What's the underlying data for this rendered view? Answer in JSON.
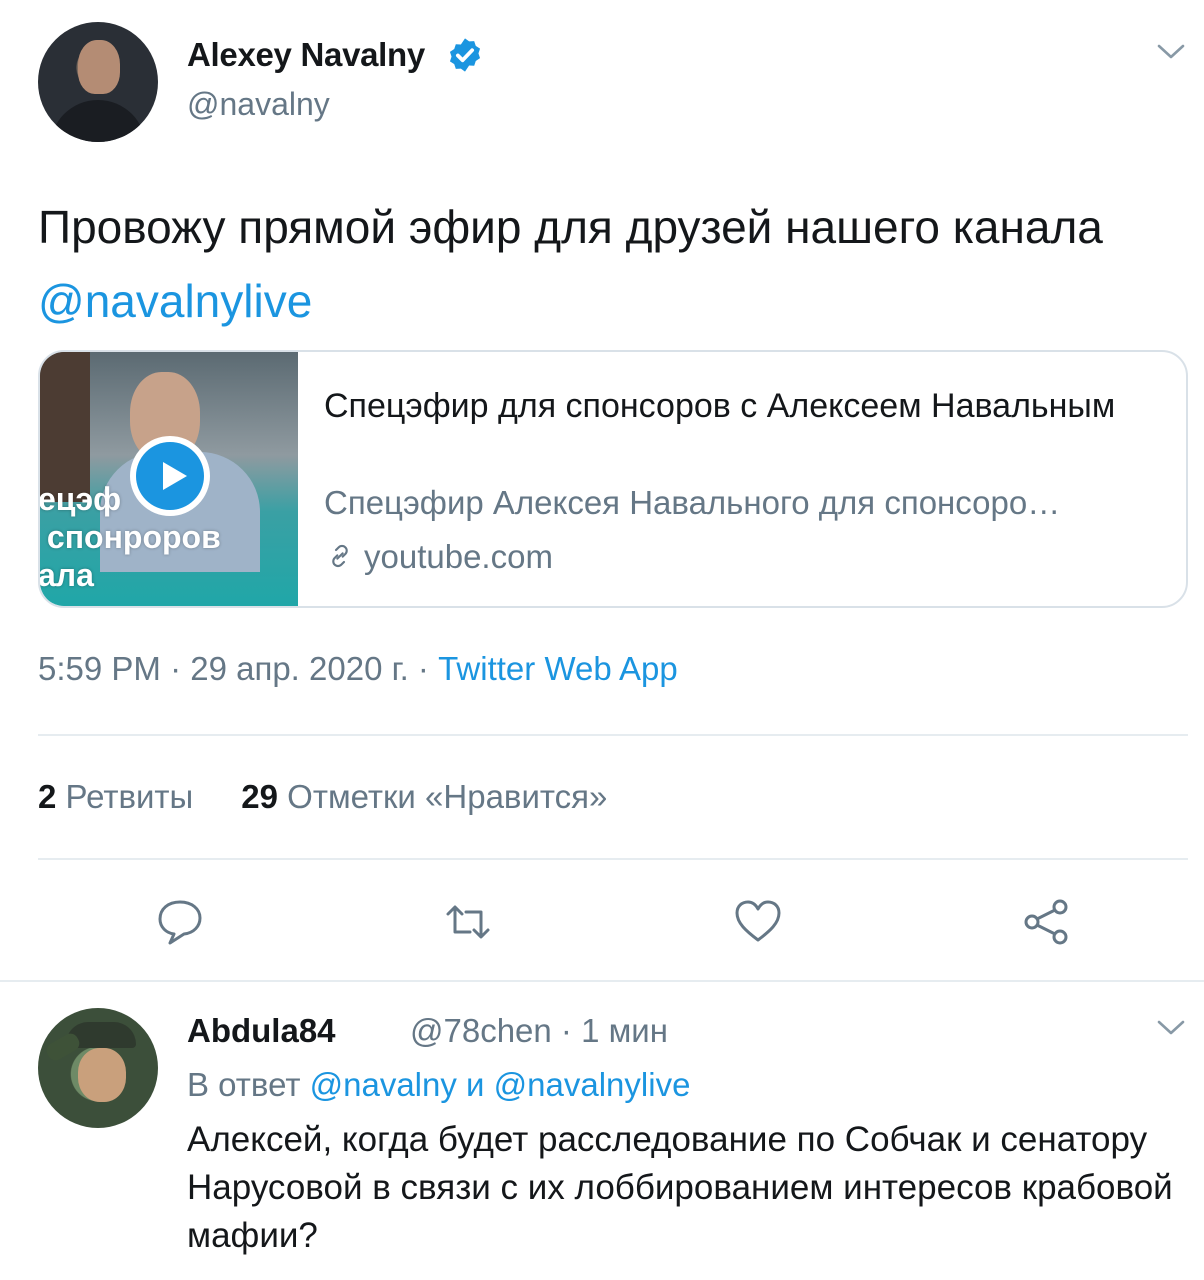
{
  "tweet": {
    "author_name": "Alexey Navalny",
    "author_handle": "@navalny",
    "text_prefix": "Провожу прямой эфир для друзей нашего канала ",
    "text_mention": "@navalnylive",
    "timestamp": "5:59 PM · 29 апр. 2020 г. · ",
    "source": "Twitter Web App",
    "retweets_count": "2",
    "retweets_label": "Ретвиты",
    "likes_count": "29",
    "likes_label": "Отметки «Нравится»"
  },
  "card": {
    "thumb_caption": "ецэф\n спонроров\nала",
    "title": "Спецэфир для спонсоров с Алексеем Навальным",
    "description": "Спецэфир Алексея Навального для спонсоро…",
    "domain": "youtube.com"
  },
  "reply": {
    "author_name": "Abdula84",
    "meta": "@78chen · 1 мин",
    "reply_to_prefix": "В ответ ",
    "reply_to_mention_1": "@navalny",
    "reply_to_joiner": " и ",
    "reply_to_mention_2": "@navalnylive",
    "text": "Алексей, когда будет расследование по Собчак и сенатору Нарусовой в связи с их лоббированием интересов крабовой мафии?"
  },
  "icons": [
    "verified-badge-icon",
    "chevron-down-icon",
    "play-icon",
    "link-icon",
    "reply-icon",
    "retweet-icon",
    "like-icon",
    "share-icon"
  ],
  "colors": {
    "accent": "#1b95e0",
    "secondary_text": "#657786",
    "text": "#14171a",
    "divider": "#e6ecf0"
  }
}
